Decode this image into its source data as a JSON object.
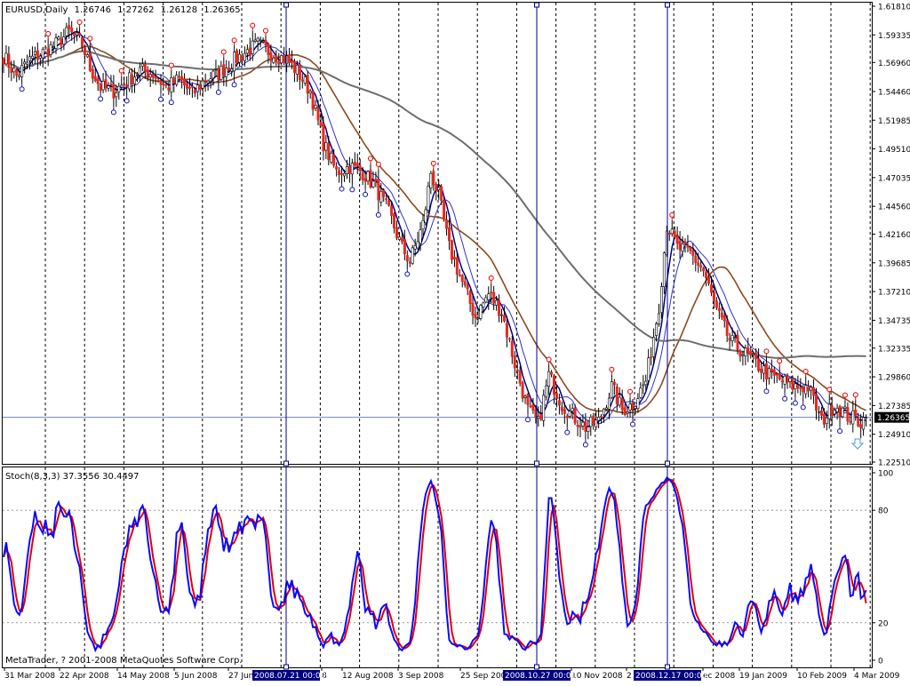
{
  "main_panel": {
    "symbol": "EURUSD,Daily",
    "ohlc": [
      "1.26746",
      "1.27262",
      "1.26128",
      "1.26365"
    ],
    "current_price": 1.26365,
    "current_price_label": "1.26365",
    "price_ticks": [
      1.6181,
      1.59335,
      1.5696,
      1.5446,
      1.51985,
      1.4951,
      1.47035,
      1.4456,
      1.4216,
      1.39685,
      1.3721,
      1.34735,
      1.32335,
      1.2986,
      1.27385,
      1.2491,
      1.2251
    ],
    "price_tick_labels": [
      "1.61810",
      "1.59335",
      "1.56960",
      "1.54460",
      "1.51985",
      "1.49510",
      "1.47035",
      "1.44560",
      "1.42160",
      "1.39685",
      "1.37210",
      "1.34735",
      "1.32335",
      "1.29860",
      "1.27385",
      "1.24910",
      "1.22510"
    ]
  },
  "stoch_panel": {
    "label": "Stoch(8,3,3) 37.3556 30.4497",
    "levels": [
      100,
      80,
      20,
      0
    ],
    "level_labels": [
      "100",
      "80",
      "20",
      "0"
    ]
  },
  "footer": {
    "copyright": "MetaTrader, ? 2001-2008 MetaQuotes Software Corp."
  },
  "x_axis": {
    "labels": [
      "31 Mar 2008",
      "22 Apr 2008",
      "14 May 2008",
      "5 Jun 2008",
      "27 Jun",
      "8",
      "12 Aug 2008",
      "3 Sep 2008",
      "25 Sep 2008",
      "10 Nov 2008",
      "2",
      "ec 2008",
      "19 Jan 2009",
      "10 Feb 2009",
      "4 Mar 2009"
    ],
    "crosshair_labels": [
      "2008.07.21 00:00",
      "2008.10.27 00:00",
      "2008.12.17 00:00"
    ]
  },
  "colors": {
    "bull_candle": "#ffffff",
    "bear_candle": "#e8281e",
    "ma_fast": "#00007a",
    "ma_mid": "#3030c8",
    "ma_slow": "#8b4a1e",
    "ma_long": "#6e6e6e",
    "stoch_main": "#0a0aff",
    "stoch_signal": "#e00000",
    "crosshair": "#000080"
  },
  "chart_data": [
    {
      "type": "candlestick",
      "title": "EURUSD,Daily",
      "ylim": [
        1.2251,
        1.6181
      ],
      "anchors": [
        [
          0,
          1.575
        ],
        [
          5,
          1.558
        ],
        [
          10,
          1.572
        ],
        [
          15,
          1.578
        ],
        [
          20,
          1.585
        ],
        [
          25,
          1.596
        ],
        [
          30,
          1.585
        ],
        [
          33,
          1.565
        ],
        [
          37,
          1.548
        ],
        [
          42,
          1.545
        ],
        [
          47,
          1.553
        ],
        [
          52,
          1.563
        ],
        [
          57,
          1.56
        ],
        [
          62,
          1.548
        ],
        [
          67,
          1.555
        ],
        [
          72,
          1.542
        ],
        [
          77,
          1.555
        ],
        [
          82,
          1.56
        ],
        [
          87,
          1.57
        ],
        [
          92,
          1.578
        ],
        [
          97,
          1.585
        ],
        [
          102,
          1.578
        ],
        [
          108,
          1.572
        ],
        [
          112,
          1.562
        ],
        [
          117,
          1.545
        ],
        [
          122,
          1.5
        ],
        [
          127,
          1.475
        ],
        [
          132,
          1.48
        ],
        [
          137,
          1.475
        ],
        [
          142,
          1.462
        ],
        [
          147,
          1.44
        ],
        [
          152,
          1.41
        ],
        [
          155,
          1.398
        ],
        [
          160,
          1.43
        ],
        [
          163,
          1.475
        ],
        [
          166,
          1.455
        ],
        [
          170,
          1.41
        ],
        [
          175,
          1.38
        ],
        [
          180,
          1.35
        ],
        [
          185,
          1.37
        ],
        [
          190,
          1.355
        ],
        [
          195,
          1.31
        ],
        [
          200,
          1.27
        ],
        [
          204,
          1.258
        ],
        [
          208,
          1.3
        ],
        [
          213,
          1.275
        ],
        [
          217,
          1.265
        ],
        [
          222,
          1.255
        ],
        [
          227,
          1.26
        ],
        [
          232,
          1.29
        ],
        [
          236,
          1.27
        ],
        [
          240,
          1.275
        ],
        [
          245,
          1.295
        ],
        [
          250,
          1.36
        ],
        [
          253,
          1.43
        ],
        [
          257,
          1.41
        ],
        [
          262,
          1.405
        ],
        [
          267,
          1.39
        ],
        [
          272,
          1.355
        ],
        [
          277,
          1.33
        ],
        [
          282,
          1.32
        ],
        [
          287,
          1.31
        ],
        [
          292,
          1.3
        ],
        [
          297,
          1.295
        ],
        [
          302,
          1.29
        ],
        [
          307,
          1.29
        ],
        [
          312,
          1.26
        ],
        [
          317,
          1.275
        ],
        [
          322,
          1.265
        ],
        [
          327,
          1.26
        ],
        [
          329,
          1.2637
        ]
      ],
      "moving_averages": [
        {
          "periods": 5
        },
        {
          "periods": 10
        },
        {
          "periods": 25
        },
        {
          "periods": 100
        }
      ],
      "fractal_count": 34
    },
    {
      "type": "line",
      "title": "Stoch(8,3,3) 37.3556 30.4497",
      "ylim": [
        0,
        100
      ],
      "levels": [
        20,
        80
      ],
      "last_values": {
        "main": 37.3556,
        "signal": 30.4497
      }
    }
  ]
}
